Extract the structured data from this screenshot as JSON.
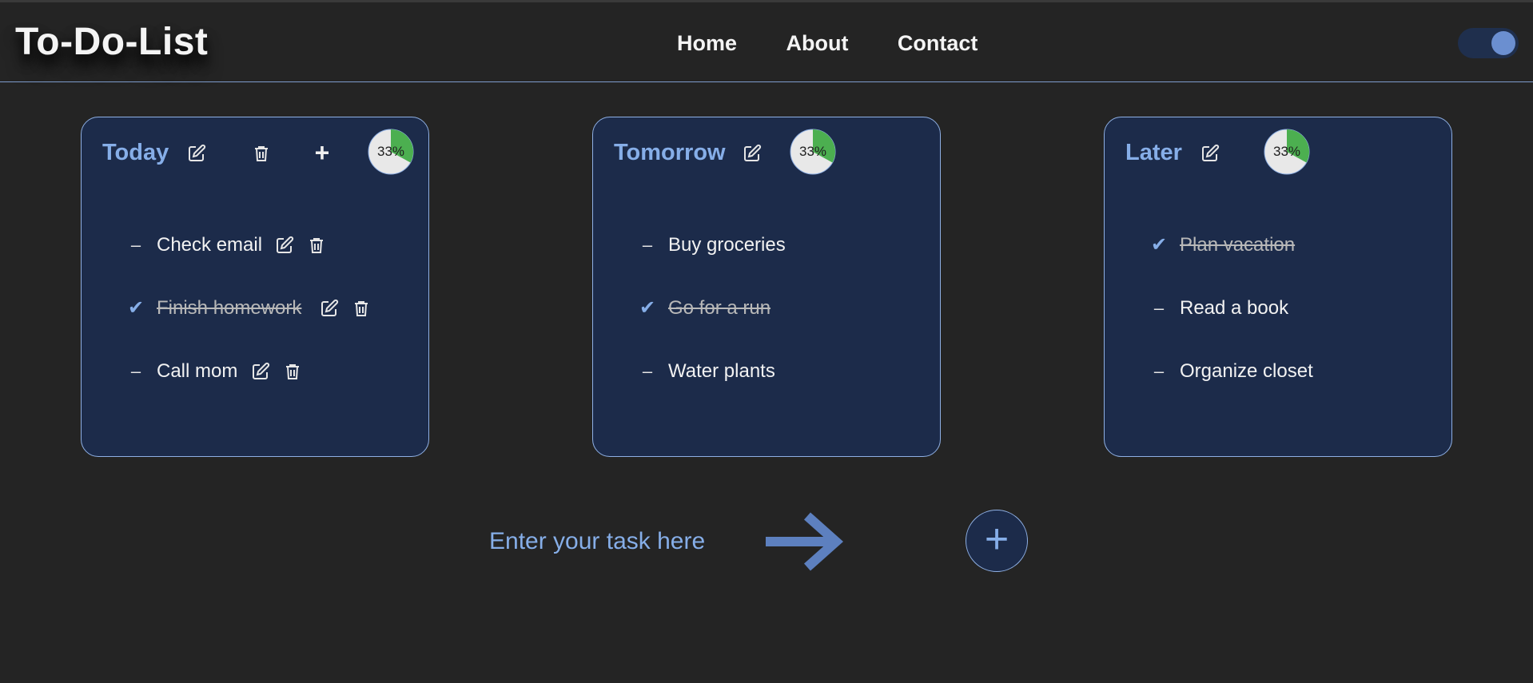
{
  "app": {
    "title": "To-Do-List"
  },
  "nav": {
    "items": [
      "Home",
      "About",
      "Contact"
    ]
  },
  "theme_toggle": {
    "state": "on"
  },
  "colors": {
    "background": "#242424",
    "card": "#1c2b4a",
    "accent": "#86aee8",
    "progress_fill": "#4caf50",
    "progress_track": "#e8e8e8"
  },
  "lists": [
    {
      "title": "Today",
      "progress_label": "33%",
      "progress": 0.33,
      "tasks": [
        {
          "text": "Check email",
          "done": false
        },
        {
          "text": "Finish homework",
          "done": true
        },
        {
          "text": "Call mom",
          "done": false
        }
      ]
    },
    {
      "title": "Tomorrow",
      "progress_label": "33%",
      "progress": 0.33,
      "tasks": [
        {
          "text": "Buy groceries",
          "done": false
        },
        {
          "text": "Go for a run",
          "done": true
        },
        {
          "text": "Water plants",
          "done": false
        }
      ]
    },
    {
      "title": "Later",
      "progress_label": "33%",
      "progress": 0.33,
      "tasks": [
        {
          "text": "Plan vacation",
          "done": true
        },
        {
          "text": "Read a book",
          "done": false
        },
        {
          "text": "Organize closet",
          "done": false
        }
      ]
    }
  ],
  "markers": {
    "pending": "–",
    "done": "✔"
  },
  "new_task": {
    "placeholder": "Enter your task here",
    "value": ""
  },
  "add_button": {
    "label": "+"
  },
  "icons": {
    "edit": "edit-icon",
    "delete": "trash-icon",
    "add": "plus-icon",
    "submit": "arrow-right-icon"
  }
}
